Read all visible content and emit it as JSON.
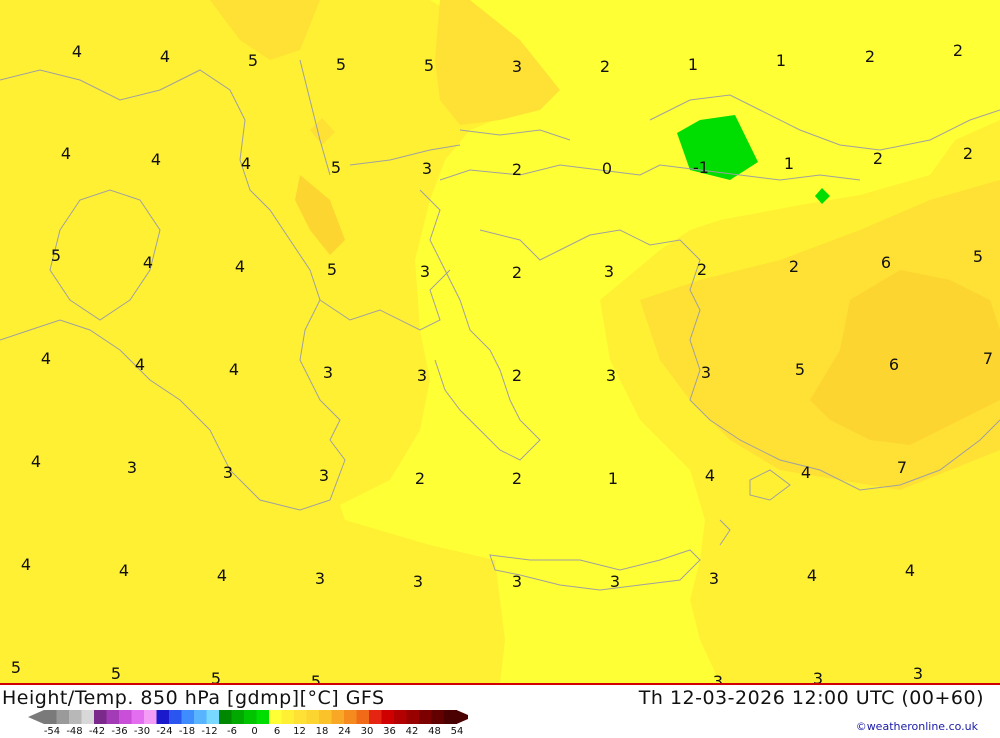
{
  "map": {
    "title": "Height/Temp. 850 hPa [gdmp][°C] GFS",
    "timestamp": "Th 12-03-2026 12:00 UTC (00+60)",
    "credit": "©weatheronline.co.uk",
    "colors": {
      "band_0_2": "#ffff35",
      "band_2_4": "#fff033",
      "band_4_6": "#ffe035",
      "band_6_8": "#fdd530",
      "band_minus": "#00dd00",
      "coastline": "#a0a0a0"
    },
    "labels": [
      {
        "t": "4"
      },
      {
        "t": "4"
      },
      {
        "t": "5"
      },
      {
        "t": "5"
      },
      {
        "t": "5"
      },
      {
        "t": "3"
      },
      {
        "t": "2"
      },
      {
        "t": "1"
      },
      {
        "t": "1"
      },
      {
        "t": "2"
      },
      {
        "t": "2"
      },
      {
        "t": "4"
      },
      {
        "t": "4"
      },
      {
        "t": "4"
      },
      {
        "t": "5"
      },
      {
        "t": "3"
      },
      {
        "t": "2"
      },
      {
        "t": "0"
      },
      {
        "t": "-1"
      },
      {
        "t": "1"
      },
      {
        "t": "2"
      },
      {
        "t": "2"
      },
      {
        "t": "5"
      },
      {
        "t": "4"
      },
      {
        "t": "4"
      },
      {
        "t": "5"
      },
      {
        "t": "3"
      },
      {
        "t": "2"
      },
      {
        "t": "3"
      },
      {
        "t": "2"
      },
      {
        "t": "2"
      },
      {
        "t": "6"
      },
      {
        "t": "5"
      },
      {
        "t": "4"
      },
      {
        "t": "4"
      },
      {
        "t": "4"
      },
      {
        "t": "3"
      },
      {
        "t": "3"
      },
      {
        "t": "2"
      },
      {
        "t": "3"
      },
      {
        "t": "3"
      },
      {
        "t": "5"
      },
      {
        "t": "6"
      },
      {
        "t": "7"
      },
      {
        "t": "4"
      },
      {
        "t": "3"
      },
      {
        "t": "3"
      },
      {
        "t": "3"
      },
      {
        "t": "2"
      },
      {
        "t": "2"
      },
      {
        "t": "1"
      },
      {
        "t": "4"
      },
      {
        "t": "4"
      },
      {
        "t": "7"
      },
      {
        "t": "4"
      },
      {
        "t": "4"
      },
      {
        "t": "4"
      },
      {
        "t": "3"
      },
      {
        "t": "3"
      },
      {
        "t": "3"
      },
      {
        "t": "3"
      },
      {
        "t": "3"
      },
      {
        "t": "4"
      },
      {
        "t": "4"
      },
      {
        "t": "5"
      },
      {
        "t": "5"
      },
      {
        "t": "5"
      },
      {
        "t": "5"
      },
      {
        "t": "3"
      },
      {
        "t": "3"
      },
      {
        "t": "3"
      }
    ]
  },
  "legend": {
    "ticks": [
      "-54",
      "-48",
      "-42",
      "-36",
      "-30",
      "-24",
      "-18",
      "-12",
      "-6",
      "0",
      "6",
      "12",
      "18",
      "24",
      "30",
      "36",
      "42",
      "48",
      "54"
    ],
    "colors": [
      "#7a7a7a",
      "#9a9a9a",
      "#b8b8b8",
      "#d8d8d8",
      "#7b2a8c",
      "#a23bb5",
      "#c94fd8",
      "#e36ef0",
      "#f59cf7",
      "#1a1acc",
      "#2a55ee",
      "#3f8cff",
      "#58b4ff",
      "#78d8ff",
      "#008800",
      "#00a800",
      "#00c400",
      "#00dd00",
      "#ffff35",
      "#fff033",
      "#ffe035",
      "#fdd530",
      "#fcc22a",
      "#f9a825",
      "#f58a1e",
      "#f06a18",
      "#e52412",
      "#d00000",
      "#b30000",
      "#990000",
      "#7d0000",
      "#620000",
      "#4a0000"
    ]
  }
}
